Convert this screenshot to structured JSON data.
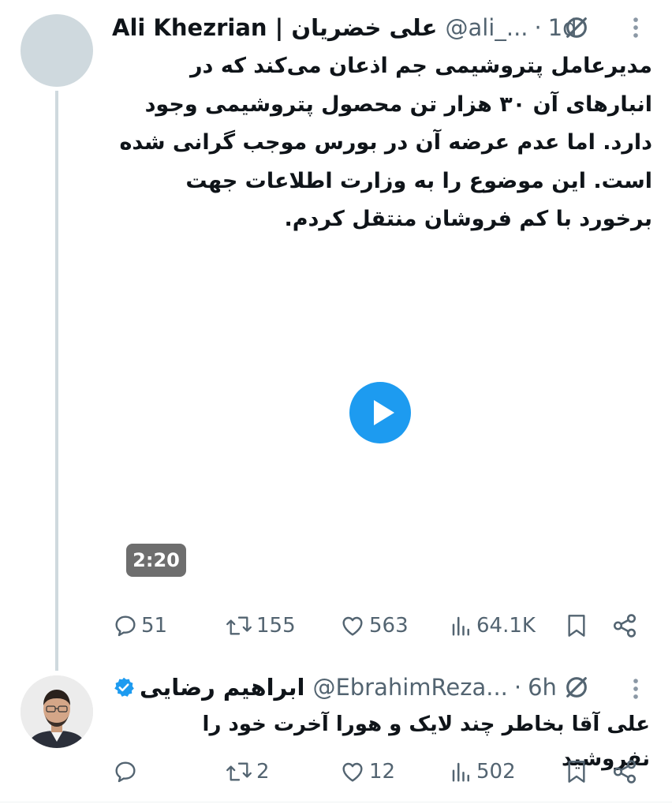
{
  "tweet1": {
    "display_name": "Ali Khezrian | علی خضریان",
    "handle": "@ali_...",
    "separator": "·",
    "time": "1d",
    "text": "مدیرعامل پتروشیمی جم اذعان می‌کند که در انبارهای آن ۳۰ هزار تن محصول پتروشیمی وجود دارد. اما عدم عرضه آن در بورس موجب گرانی شده است. این موضوع را به وزارت اطلاعات جهت برخورد با کم فروشان منتقل کردم.",
    "video_duration": "2:20",
    "replies": "51",
    "reposts": "155",
    "likes": "563",
    "views": "64.1K"
  },
  "tweet2": {
    "display_name": "ابراهیم رضایی",
    "handle": "@EbrahimReza...",
    "separator": "·",
    "time": "6h",
    "text": "علی آقا بخاطر چند لایک و هورا آخرت خود را نفروشید",
    "replies": "",
    "reposts": "2",
    "likes": "12",
    "views": "502"
  },
  "colors": {
    "accent": "#1d9bf0",
    "secondary_text": "#536471",
    "thread_line": "#cfd9de"
  }
}
